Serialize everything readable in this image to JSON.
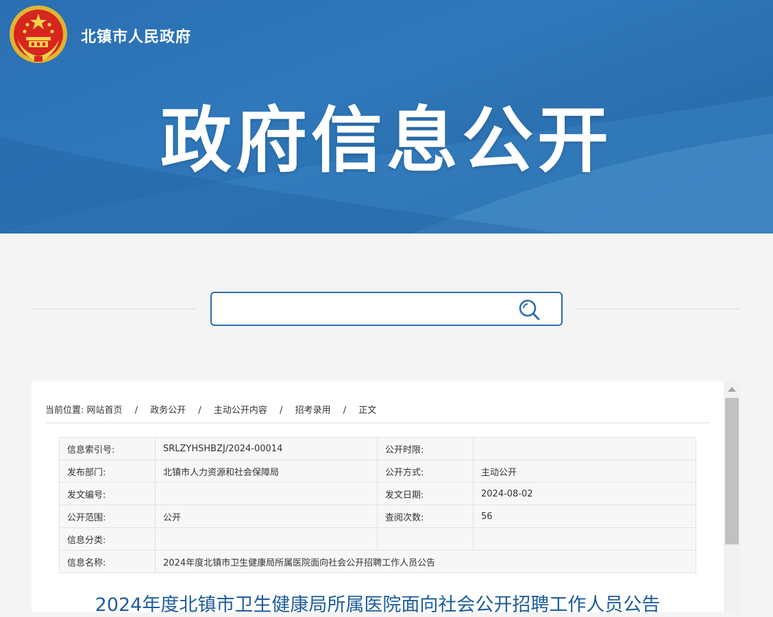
{
  "header": {
    "site_name": "北镇市人民政府",
    "banner_title": "政府信息公开",
    "emblem_icon": "national-emblem-icon",
    "colors": {
      "banner": "#2a6fb2",
      "accent": "#2b6cae",
      "title": "#1e5c9b"
    }
  },
  "search": {
    "placeholder": "",
    "value": "",
    "icon": "search-icon"
  },
  "breadcrumb": {
    "prefix": "当前位置:",
    "items": [
      "网站首页",
      "政务公开",
      "主动公开内容",
      "招考录用",
      "正文"
    ],
    "separator": "/"
  },
  "meta": {
    "rows": [
      {
        "label1": "信息索引号:",
        "value1": "SRLZYHSHBZJ/2024-00014",
        "label2": "公开时限:",
        "value2": ""
      },
      {
        "label1": "发布部门:",
        "value1": "北镇市人力资源和社会保障局",
        "label2": "公开方式:",
        "value2": "主动公开"
      },
      {
        "label1": "发文编号:",
        "value1": "",
        "label2": "发文日期:",
        "value2": "2024-08-02"
      },
      {
        "label1": "公开范围:",
        "value1": "公开",
        "label2": "查阅次数:",
        "value2": "56"
      },
      {
        "label1": "信息分类:",
        "value1": "",
        "label2": "",
        "value2": ""
      }
    ],
    "name_label": "信息名称:",
    "name_value": "2024年度北镇市卫生健康局所属医院面向社会公开招聘工作人员公告"
  },
  "article": {
    "title": "2024年度北镇市卫生健康局所属医院面向社会公开招聘工作人员公告"
  }
}
